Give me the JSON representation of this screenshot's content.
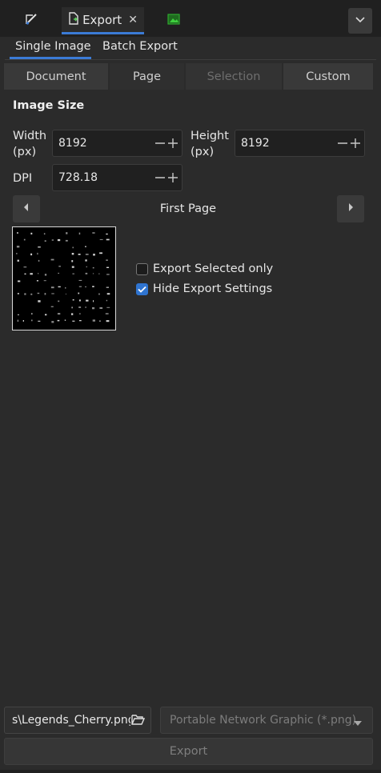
{
  "tabs": [
    {
      "icon": "brush-icon"
    },
    {
      "label": "Export",
      "icon": "export-file-icon",
      "active": true
    },
    {
      "icon": "image-icon"
    }
  ],
  "subtabs": [
    "Single Image",
    "Batch Export"
  ],
  "segments": [
    "Document",
    "Page",
    "Selection",
    "Custom"
  ],
  "image_size": {
    "title": "Image Size",
    "width_label": "Width\n(px)",
    "width_value": "8192",
    "height_label": "Height\n(px)",
    "height_value": "8192",
    "dpi_label": "DPI",
    "dpi_value": "728.18"
  },
  "page_nav": {
    "label": "First Page"
  },
  "options": {
    "export_selected_label": "Export Selected only",
    "export_selected_checked": false,
    "hide_settings_label": "Hide Export Settings",
    "hide_settings_checked": true
  },
  "output": {
    "path": "s\\Legends_Cherry.png",
    "format": "Portable Network Graphic (*.png)",
    "export_label": "Export"
  },
  "colors": {
    "accent": "#3b7bd6",
    "background": "#2b2b2b",
    "field": "#202020"
  }
}
